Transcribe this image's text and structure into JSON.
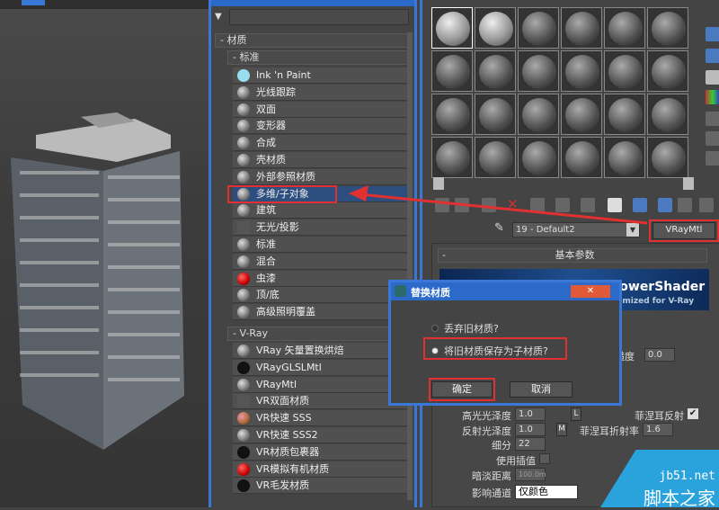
{
  "browser": {
    "search_placeholder": "",
    "group_materials": "- 材质",
    "group_standard": "- 标准",
    "standard_items": [
      "Ink 'n Paint",
      "光线跟踪",
      "双面",
      "变形器",
      "合成",
      "壳材质",
      "外部参照材质",
      "多维/子对象",
      "建筑",
      "无光/投影",
      "标准",
      "混合",
      "虫漆",
      "顶/底",
      "高级照明覆盖"
    ],
    "selected_item": "多维/子对象",
    "group_vray": "- V-Ray",
    "vray_items": [
      "VRay 矢量置换烘焙",
      "VRayGLSLMtl",
      "VRayMtl",
      "VR双面材质",
      "VR快速 SSS",
      "VR快速 SSS2",
      "VR材质包裹器",
      "VR模拟有机材质",
      "VR毛发材质"
    ]
  },
  "editor": {
    "material_name": "19 - Default2",
    "material_type": "VRayMtl",
    "rollout_title": "基本参数",
    "banner_title": "PowerShader",
    "banner_subtitle": "timized for V-Ray",
    "roughness_label": "粗糙度",
    "roughness": "0.0",
    "hilight_gloss_label": "高光光泽度",
    "hilight_gloss": "1.0",
    "lock_L": "L",
    "refl_gloss_label": "反射光泽度",
    "refl_gloss": "1.0",
    "map_M": "M",
    "subdivs_label": "细分",
    "subdivs": "22",
    "use_interp_label": "使用插值",
    "dim_dist_label": "暗淡距离",
    "dim_dist": "100.0m",
    "affect_channels_label": "影响通道",
    "affect_channels": "仅颜色",
    "fresnel_label": "菲涅耳反射",
    "fresnel_checked": true,
    "fresnel_ior_label": "菲涅耳折射率",
    "fresnel_ior": "1.6"
  },
  "dialog": {
    "title": "替换材质",
    "close": "✕",
    "option_discard": "丢弃旧材质?",
    "option_keep": "将旧材质保存为子材质?",
    "selected_option": "option_keep",
    "ok": "确定",
    "cancel": "取消"
  },
  "watermark": {
    "site": "jb51.net",
    "name": "脚本之家"
  },
  "colors": {
    "highlight": "#e03030",
    "accent": "#3a78d8"
  }
}
